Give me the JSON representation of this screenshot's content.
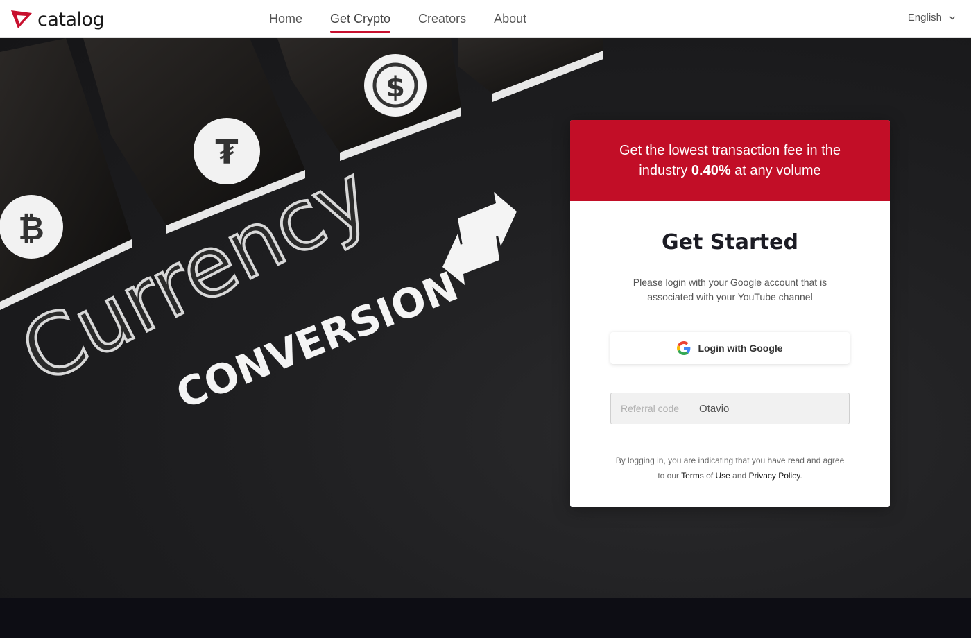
{
  "header": {
    "logo_text": "catalog",
    "nav": [
      {
        "label": "Home",
        "active": false
      },
      {
        "label": "Get Crypto",
        "active": true
      },
      {
        "label": "Creators",
        "active": false
      },
      {
        "label": "About",
        "active": false
      }
    ],
    "language": "English",
    "language_icon": "chevron-down-icon"
  },
  "hero": {
    "art_text_1": "Currency",
    "art_text_2": "CONVERSION",
    "art_icons": [
      "bitcoin-icon",
      "tether-icon",
      "usd-coin-icon",
      "swap-arrows-icon"
    ]
  },
  "card": {
    "banner_prefix": "Get the lowest transaction fee in the industry",
    "banner_highlight": "0.40%",
    "banner_suffix": "at any volume",
    "title": "Get Started",
    "subtitle": "Please login with your Google account that is associated with your YouTube channel",
    "google_button_label": "Login with Google",
    "referral_label": "Referral code",
    "referral_value": "Otavio",
    "legal_prefix": "By logging in, you are indicating that you have read and agree to our",
    "terms_label": "Terms of Use",
    "legal_and": "and",
    "privacy_label": "Privacy Policy",
    "legal_suffix": "."
  },
  "colors": {
    "brand_red": "#c20e27",
    "hero_dark": "#1f1f21"
  }
}
